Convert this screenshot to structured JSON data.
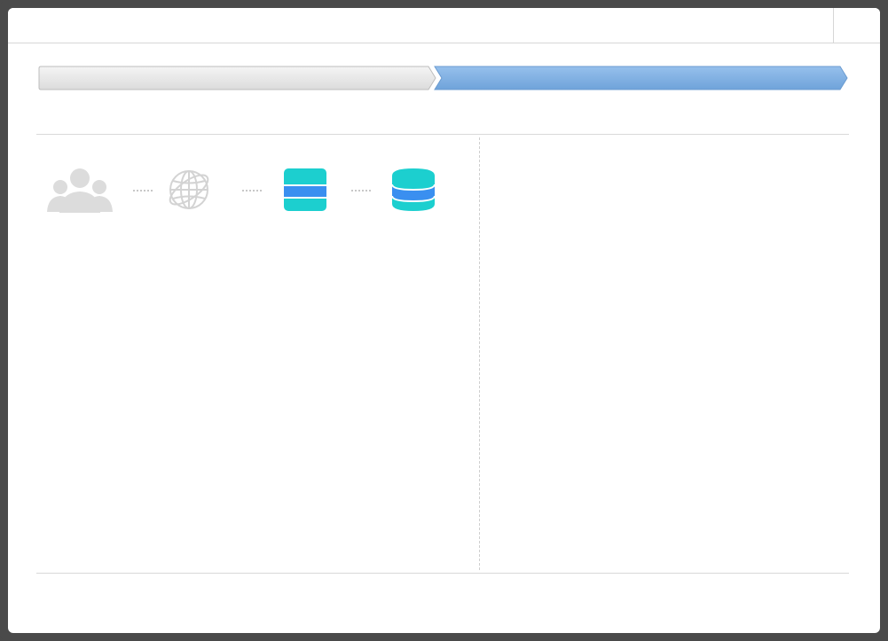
{
  "window": {
    "title": ""
  },
  "steps": [
    {
      "label": "",
      "state": "completed"
    },
    {
      "label": "",
      "state": "active"
    }
  ],
  "colors": {
    "step_inactive": "#e8e8e8",
    "step_active": "#7fb0e0",
    "people_icon": "#dcdcdc",
    "globe_icon": "#d6d6d6",
    "teal": "#1ccfcf",
    "blue": "#3a8ff0"
  },
  "pipeline": [
    {
      "icon": "users-group-icon"
    },
    {
      "icon": "globe-icon"
    },
    {
      "icon": "server-stack-icon"
    },
    {
      "icon": "database-icon"
    }
  ]
}
